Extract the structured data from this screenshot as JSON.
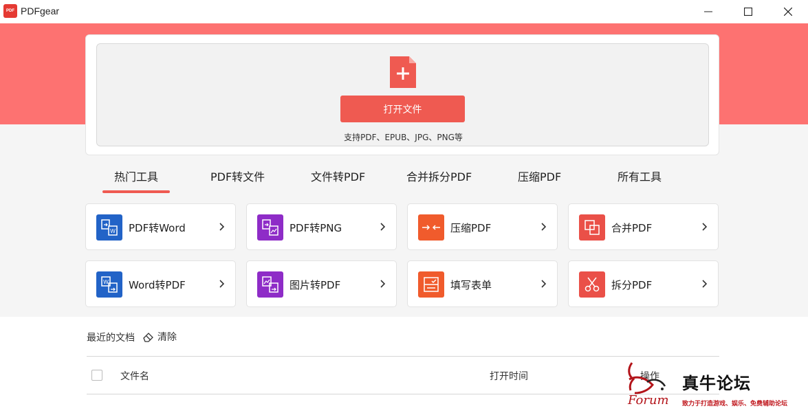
{
  "app": {
    "title": "PDFgear",
    "logo_text": "PDF"
  },
  "colors": {
    "brand_red": "#ef5a51",
    "banner": "#fd7271",
    "word_blue": "#2263c7",
    "purple": "#8e2cc7",
    "orange": "#f05b2c",
    "red": "#ea5048"
  },
  "upload": {
    "icon": "file-plus-icon",
    "open_label": "打开文件",
    "support_text": "支持PDF、EPUB、JPG、PNG等"
  },
  "tabs": [
    {
      "label": "热门工具",
      "active": true
    },
    {
      "label": "PDF转文件",
      "active": false
    },
    {
      "label": "文件转PDF",
      "active": false
    },
    {
      "label": "合并拆分PDF",
      "active": false
    },
    {
      "label": "压缩PDF",
      "active": false
    },
    {
      "label": "所有工具",
      "active": false
    }
  ],
  "tools": [
    {
      "label": "PDF转Word",
      "icon": "pdf-to-word-icon",
      "color": "#2263c7"
    },
    {
      "label": "PDF转PNG",
      "icon": "pdf-to-png-icon",
      "color": "#8e2cc7"
    },
    {
      "label": "压缩PDF",
      "icon": "compress-icon",
      "color": "#f05b2c"
    },
    {
      "label": "合并PDF",
      "icon": "merge-icon",
      "color": "#ea5048"
    },
    {
      "label": "Word转PDF",
      "icon": "word-to-pdf-icon",
      "color": "#2263c7"
    },
    {
      "label": "图片转PDF",
      "icon": "image-to-pdf-icon",
      "color": "#8e2cc7"
    },
    {
      "label": "填写表单",
      "icon": "fill-form-icon",
      "color": "#f05b2c"
    },
    {
      "label": "拆分PDF",
      "icon": "split-icon",
      "color": "#ea5048"
    }
  ],
  "recent": {
    "title": "最近的文档",
    "clear_label": "清除",
    "columns": {
      "name": "文件名",
      "open_time": "打开时间",
      "actions": "操作"
    }
  },
  "watermark": {
    "brand": "真牛论坛",
    "forum": "Forum",
    "slogan": "致力于打造游戏、娱乐、免费辅助论坛"
  }
}
